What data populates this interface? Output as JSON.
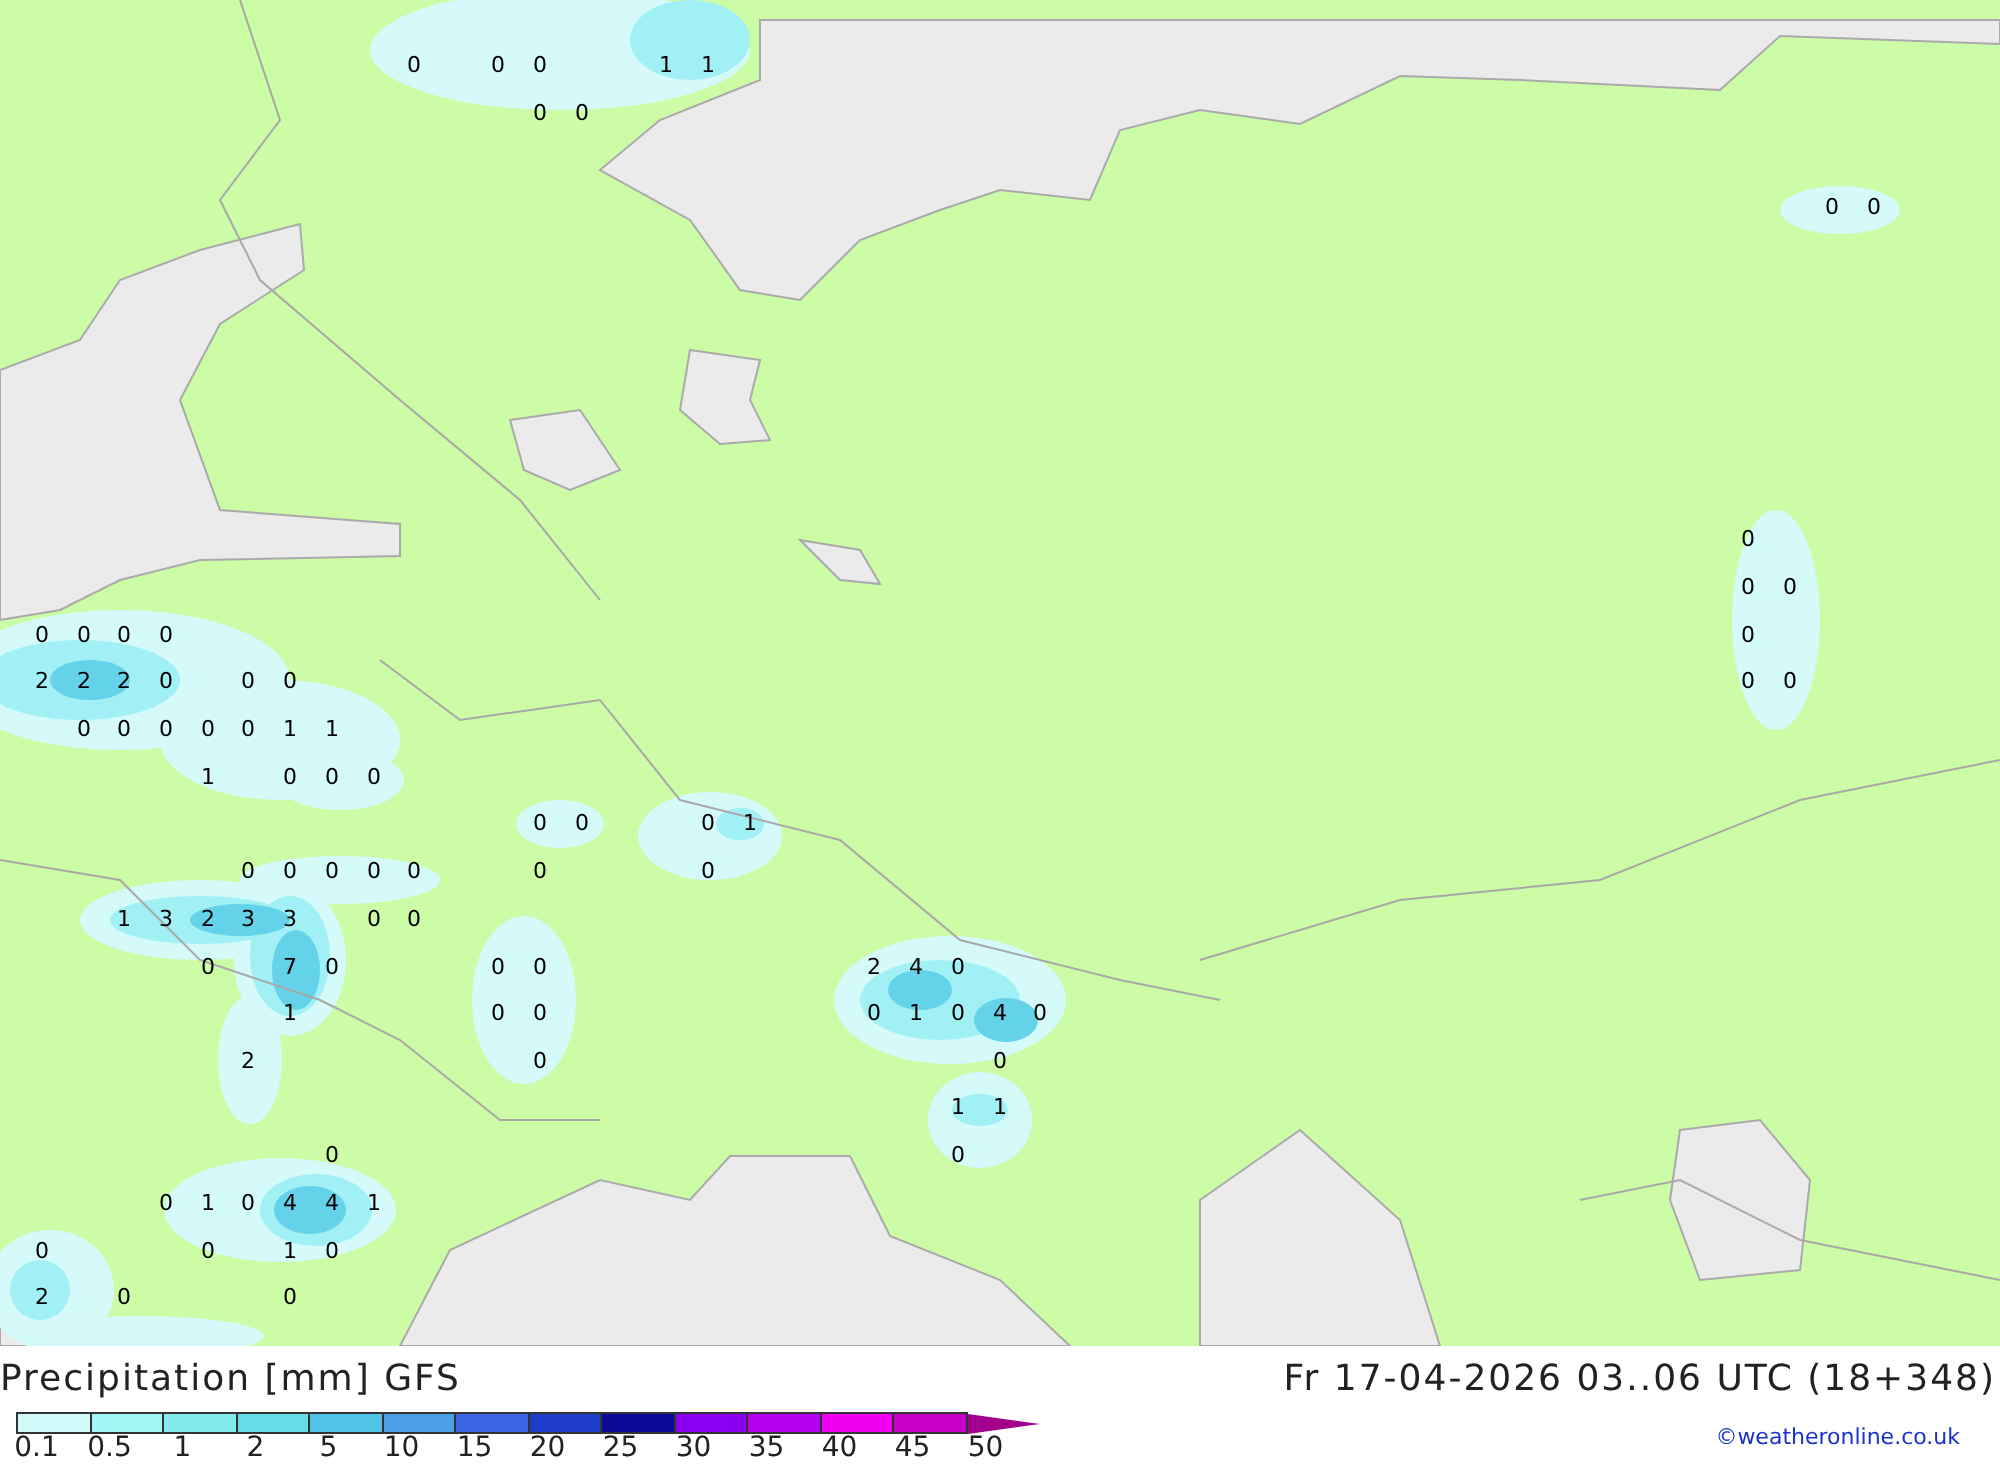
{
  "map": {
    "values": [
      "0",
      "0",
      "0",
      "1",
      "1",
      "0",
      "0",
      "0",
      "0",
      "0",
      "0",
      "0",
      "0",
      "0",
      "0",
      "0",
      "0",
      "2",
      "2",
      "2",
      "0",
      "0",
      "0",
      "0",
      "0",
      "0",
      "0",
      "0",
      "0",
      "0",
      "1",
      "1",
      "1",
      "0",
      "0",
      "0",
      "0",
      "0",
      "0",
      "1",
      "0",
      "0",
      "0",
      "0",
      "0",
      "0",
      "0",
      "1",
      "3",
      "2",
      "3",
      "3",
      "0",
      "0",
      "0",
      "7",
      "0",
      "0",
      "0",
      "2",
      "4",
      "0",
      "1",
      "0",
      "0",
      "0",
      "1",
      "0",
      "4",
      "0",
      "2",
      "0",
      "0",
      "1",
      "1",
      "0",
      "0",
      "0",
      "1",
      "0",
      "4",
      "4",
      "1",
      "0",
      "0",
      "1",
      "0",
      "2",
      "0",
      "0"
    ]
  },
  "legend": {
    "title": "Precipitation [mm] GFS",
    "valid_time": "Fr 17-04-2026 03..06 UTC (18+348)",
    "bins": [
      {
        "kind": "box",
        "color": "#d2fafa"
      },
      {
        "kind": "box",
        "color": "#a0f5f5"
      },
      {
        "kind": "box",
        "color": "#82ebeb"
      },
      {
        "kind": "box",
        "color": "#64dce6"
      },
      {
        "kind": "box",
        "color": "#50c3e6"
      },
      {
        "kind": "box",
        "color": "#4ba0e6"
      },
      {
        "kind": "box",
        "color": "#3c64e6"
      },
      {
        "kind": "box",
        "color": "#1e3cc8"
      },
      {
        "kind": "box",
        "color": "#0a0a96"
      },
      {
        "kind": "box",
        "color": "#8c00f0"
      },
      {
        "kind": "box",
        "color": "#b400f0"
      },
      {
        "kind": "box",
        "color": "#f000f0"
      },
      {
        "kind": "box",
        "color": "#c800c8"
      },
      {
        "kind": "arrow",
        "color": "#a0008c"
      }
    ],
    "ticks": [
      "0.1",
      "0.5",
      "1",
      "2",
      "5",
      "10",
      "15",
      "20",
      "25",
      "30",
      "35",
      "40",
      "45",
      "50"
    ],
    "credit": "©weatheronline.co.uk"
  }
}
